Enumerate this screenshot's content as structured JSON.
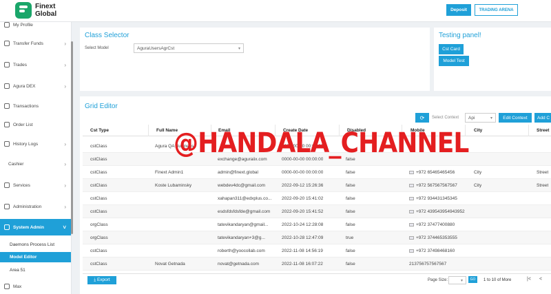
{
  "header": {
    "logo_line1": "Finext",
    "logo_line2": "Global",
    "deposit_label": "Deposit",
    "arena_label": "TRADING ARENA"
  },
  "sidebar": {
    "items": [
      {
        "label": "My Profile",
        "icon": "user-icon"
      },
      {
        "label": "Transfer Funds",
        "icon": "transfer-icon",
        "chevron": true
      },
      {
        "label": "Trades",
        "icon": "trades-icon",
        "chevron": true
      },
      {
        "label": "Agura DEX",
        "icon": "exchange-icon",
        "chevron": true
      },
      {
        "label": "Transactions",
        "icon": "transactions-icon"
      },
      {
        "label": "Order List",
        "icon": "list-icon"
      },
      {
        "label": "History Logs",
        "icon": "history-icon",
        "chevron": true
      },
      {
        "label": "Cashier",
        "icon": "",
        "chevron": true
      },
      {
        "label": "Services",
        "icon": "services-icon",
        "chevron": true
      },
      {
        "label": "Administration",
        "icon": "admin-icon",
        "chevron": true
      },
      {
        "label": "System Admin",
        "icon": "system-icon",
        "chevron": true,
        "active": true
      }
    ],
    "subitems": [
      {
        "label": "Daemons Process List"
      },
      {
        "label": "Model Editor",
        "active": true
      },
      {
        "label": "Area 51"
      },
      {
        "label": "Max"
      }
    ]
  },
  "class_selector": {
    "title": "Class Selector",
    "select_label": "Select Model",
    "select_value": "AguraUsersAgrCst"
  },
  "testing_panel": {
    "title": "Testing panel!",
    "btn1": "Cst Card",
    "btn2": "Model Test"
  },
  "grid_editor": {
    "title": "Grid Editor",
    "select_context_label": "Select Context",
    "context_value": "Api",
    "edit_context": "Edit Context",
    "add_context": "Add C",
    "columns": [
      "Cst Type",
      "Full Name",
      "Email",
      "Create Date",
      "Disabled",
      "Mobile",
      "City",
      "Street"
    ],
    "rows": [
      {
        "type": "cstClass",
        "name": "Agura QA Business",
        "email": "",
        "date": "0000-00-00 00:00:00",
        "disabled": "",
        "mobile": "",
        "city": "",
        "street": ""
      },
      {
        "type": "cstClass",
        "name": "",
        "email": "exchange@aguraiix.com",
        "date": "0000-00-00 00:00:00",
        "disabled": "false",
        "mobile": "",
        "city": "",
        "street": ""
      },
      {
        "type": "cstClass",
        "name": "Finext Admin1",
        "email": "admin@finext.global",
        "date": "0000-00-00 00:00:00",
        "disabled": "false",
        "mobile": "+972 65465465456",
        "city": "City",
        "street": "Street"
      },
      {
        "type": "cstClass",
        "name": "Koste Lubaminsky",
        "email": "webdev4dc@gmail.com",
        "date": "2022-09-12 15:26:36",
        "disabled": "false",
        "mobile": "+972 567567567567",
        "city": "City",
        "street": "Street"
      },
      {
        "type": "cstClass",
        "name": "",
        "email": "xahapan311@edxplus.co...",
        "date": "2022-09-20 15:41:02",
        "disabled": "false",
        "mobile": "+972 934431345345",
        "city": "",
        "street": ""
      },
      {
        "type": "cstClass",
        "name": "",
        "email": "esdsfdsfdsfde@gmail.com",
        "date": "2022-09-20 15:41:52",
        "disabled": "false",
        "mobile": "+972 439543954943952",
        "city": "",
        "street": ""
      },
      {
        "type": "orgClass",
        "name": "",
        "email": "tatevikandaryan@gmail...",
        "date": "2022-10-24 12:28:08",
        "disabled": "false",
        "mobile": "+972 37477400880",
        "city": "",
        "street": ""
      },
      {
        "type": "orgClass",
        "name": "",
        "email": "tatevikandaryan+3@g...",
        "date": "2022-10-28 12:47:09",
        "disabled": "true",
        "mobile": "+972 374465353555",
        "city": "",
        "street": ""
      },
      {
        "type": "cstClass",
        "name": "",
        "email": "roberth@yoocollab.com",
        "date": "2022-11-08 14:56:19",
        "disabled": "false",
        "mobile": "+972 37498468160",
        "city": "",
        "street": ""
      },
      {
        "type": "cstClass",
        "name": "Novat Getnada",
        "email": "novat@getnada.com",
        "date": "2022-11-08 16:07:22",
        "disabled": "false",
        "mobile": "213756757567567",
        "city": "",
        "street": ""
      }
    ],
    "export_label": "⤓ Export",
    "page_size_label": "Page Size:",
    "go_label": "GO",
    "pagination": "1 to 10 of More",
    "first_icon": "|<",
    "prev_icon": "<"
  },
  "watermark": "@HANDALA_CHANNEL",
  "colors": {
    "accent": "#1fa0d8",
    "watermark": "#e41e20",
    "logo": "#1aa66a"
  }
}
